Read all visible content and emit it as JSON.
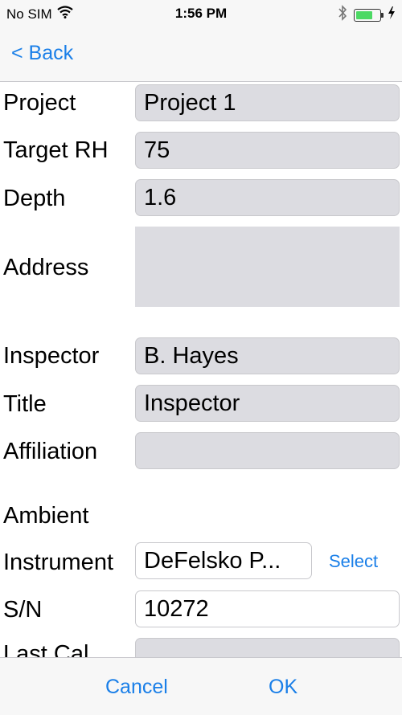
{
  "status_bar": {
    "carrier": "No SIM",
    "time": "1:56 PM",
    "battery_level": 0.75,
    "battery_color": "#4cd964"
  },
  "nav": {
    "back_label": "< Back"
  },
  "form": {
    "project": {
      "label": "Project",
      "value": "Project 1"
    },
    "target_rh": {
      "label": "Target RH",
      "value": "75"
    },
    "depth": {
      "label": "Depth",
      "value": "1.6"
    },
    "address": {
      "label": "Address",
      "value": ""
    },
    "inspector": {
      "label": "Inspector",
      "value": "B. Hayes"
    },
    "title": {
      "label": "Title",
      "value": "Inspector"
    },
    "affiliation": {
      "label": "Affiliation",
      "value": ""
    },
    "ambient_heading": "Ambient",
    "instrument": {
      "label": "Instrument",
      "value": "DeFelsko P...",
      "select_label": "Select"
    },
    "sn": {
      "label": "S/N",
      "value": "10272"
    },
    "last_cal": {
      "label": "Last Cal",
      "value": ""
    }
  },
  "toolbar": {
    "cancel_label": "Cancel",
    "ok_label": "OK"
  },
  "colors": {
    "accent": "#1a7fe8",
    "field_bg": "#dcdce1"
  }
}
